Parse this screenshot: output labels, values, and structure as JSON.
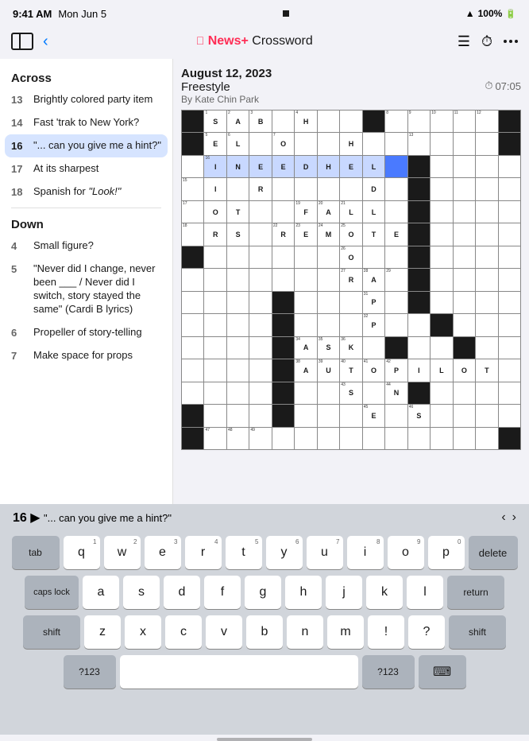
{
  "statusBar": {
    "time": "9:41 AM",
    "date": "Mon Jun 5",
    "wifi": "WiFi",
    "battery": "100%"
  },
  "navBar": {
    "title": "Crossword",
    "newsPlusLabel": "News+",
    "appleSymbol": ""
  },
  "puzzle": {
    "date": "August 12, 2023",
    "type": "Freestyle",
    "author": "By Kate Chin Park",
    "timer": "07:05"
  },
  "clues": {
    "acrossTitle": "Across",
    "downTitle": "Down",
    "across": [
      {
        "num": "13",
        "text": "Brightly colored party item"
      },
      {
        "num": "14",
        "text": "Fast 'trak to New York?"
      },
      {
        "num": "16",
        "text": "\"... can you give me a hint?\"",
        "active": true
      },
      {
        "num": "17",
        "text": "At its sharpest"
      },
      {
        "num": "18",
        "text": "Spanish for \"Look!\""
      }
    ],
    "down": [
      {
        "num": "4",
        "text": "Small figure?"
      },
      {
        "num": "5",
        "text": "\"Never did I change, never been ___ / Never did I switch, story stayed the same\" (Cardi B lyrics)"
      },
      {
        "num": "6",
        "text": "Propeller of story-telling"
      },
      {
        "num": "7",
        "text": "Make space for props"
      }
    ]
  },
  "keyboardHint": {
    "clueNum": "16",
    "arrow": "▶",
    "clueText": "\"... can you give me a hint?\""
  },
  "keyboard": {
    "row1": [
      {
        "label": "q",
        "num": "1"
      },
      {
        "label": "w",
        "num": "2"
      },
      {
        "label": "e",
        "num": "3"
      },
      {
        "label": "r",
        "num": "4"
      },
      {
        "label": "t",
        "num": "5"
      },
      {
        "label": "y",
        "num": "6"
      },
      {
        "label": "u",
        "num": "7"
      },
      {
        "label": "i",
        "num": "8"
      },
      {
        "label": "o",
        "num": "9"
      },
      {
        "label": "p",
        "num": "0"
      }
    ],
    "row2": [
      {
        "label": "a",
        "num": ""
      },
      {
        "label": "s",
        "num": ""
      },
      {
        "label": "d",
        "num": ""
      },
      {
        "label": "f",
        "num": ""
      },
      {
        "label": "g",
        "num": ""
      },
      {
        "label": "h",
        "num": ""
      },
      {
        "label": "j",
        "num": ""
      },
      {
        "label": "k",
        "num": ""
      },
      {
        "label": "l",
        "num": ""
      }
    ],
    "row3": [
      {
        "label": "z"
      },
      {
        "label": "x"
      },
      {
        "label": "c"
      },
      {
        "label": "v"
      },
      {
        "label": "b"
      },
      {
        "label": "n"
      },
      {
        "label": "m"
      },
      {
        "label": "!"
      },
      {
        "label": "?"
      }
    ],
    "tabLabel": "tab",
    "capsLabel": "caps lock",
    "shiftLabel": "shift",
    "deleteLabel": "delete",
    "returnLabel": "return",
    "num123Label": "?123",
    "emojiLabel": "🌐"
  },
  "grid": {
    "size": 15,
    "cells": []
  }
}
